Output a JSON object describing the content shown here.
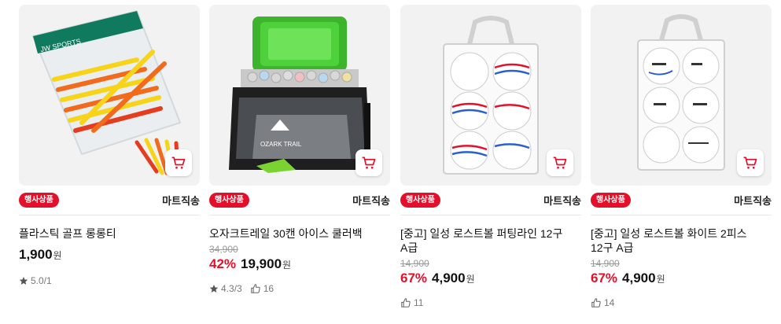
{
  "products": [
    {
      "badge": "행사상품",
      "delivery": "마트직송",
      "title": "플라스틱 골프 롱롱티",
      "original_price": "",
      "discount": "",
      "price": "1,900",
      "currency": "원",
      "rating": "5.0",
      "review_count": "/1",
      "likes": ""
    },
    {
      "badge": "행사상품",
      "delivery": "마트직송",
      "title": "오자크트레일 30캔 아이스 쿨러백",
      "original_price": "34,900",
      "discount": "42%",
      "price": "19,900",
      "currency": "원",
      "rating": "4.3",
      "review_count": "/3",
      "likes": "16"
    },
    {
      "badge": "행사상품",
      "delivery": "마트직송",
      "title": "[중고] 일성 로스트볼 퍼팅라인 12구 A급",
      "original_price": "14,900",
      "discount": "67%",
      "price": "4,900",
      "currency": "원",
      "rating": "",
      "review_count": "",
      "likes": "11"
    },
    {
      "badge": "행사상품",
      "delivery": "마트직송",
      "title": "[중고] 일성 로스트볼 화이트 2피스 12구 A급",
      "original_price": "14,900",
      "discount": "67%",
      "price": "4,900",
      "currency": "원",
      "rating": "",
      "review_count": "",
      "likes": "14"
    }
  ],
  "product_images": {
    "tees_pack_label": "JW SPORTS",
    "cooler_brand": "OZARK TRAIL"
  },
  "colors": {
    "accent": "#e3102b",
    "badge": "#e3102b",
    "thumb_bg": "#f2f2f2"
  },
  "icons": [
    "cart-icon",
    "star-icon",
    "like-hand-icon"
  ]
}
